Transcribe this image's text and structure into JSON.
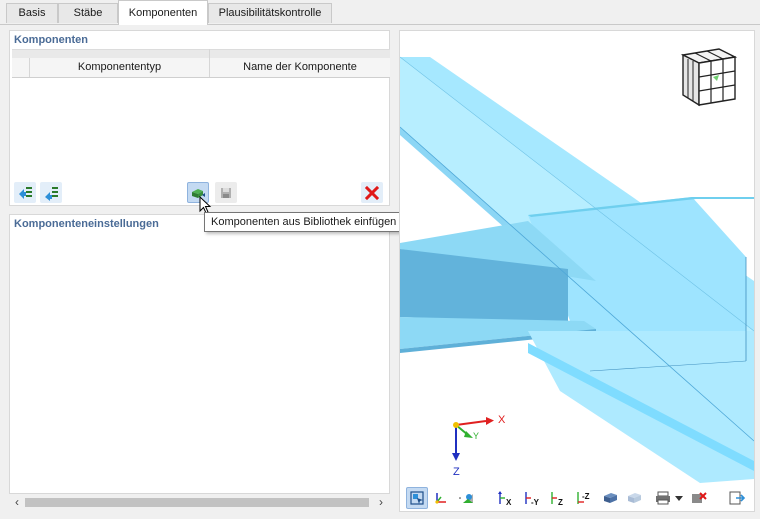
{
  "tabs": [
    {
      "label": "Basis",
      "active": false
    },
    {
      "label": "Stäbe",
      "active": false
    },
    {
      "label": "Komponenten",
      "active": true
    },
    {
      "label": "Plausibilitätskontrolle",
      "active": false
    }
  ],
  "components_panel": {
    "title": "Komponenten",
    "columns": [
      "Komponententyp",
      "Name der Komponente"
    ]
  },
  "settings_panel": {
    "title": "Komponenteneinstellungen"
  },
  "tooltip": "Komponenten aus Bibliothek einfügen",
  "axes": {
    "x": "X",
    "y": "Y",
    "z": "Z"
  },
  "colors": {
    "beam_light": "#aeeaff",
    "beam_mid": "#7fdcff",
    "beam_dark": "#4fa8d8",
    "panel_title": "#4a6b96",
    "delete_red": "#e01818"
  },
  "icons": {
    "toolbar": [
      "move-up-icon",
      "move-down-icon",
      "library-insert-icon",
      "save-to-library-icon",
      "delete-icon"
    ],
    "view_toolbar": [
      "view-select-icon",
      "axes-icon",
      "visibility-icon",
      "view-x-icon",
      "view-neg-y-icon",
      "view-neg-z-icon",
      "view-z-icon",
      "render-mode-icon",
      "print-icon",
      "reset-view-icon",
      "exit-icon"
    ]
  }
}
